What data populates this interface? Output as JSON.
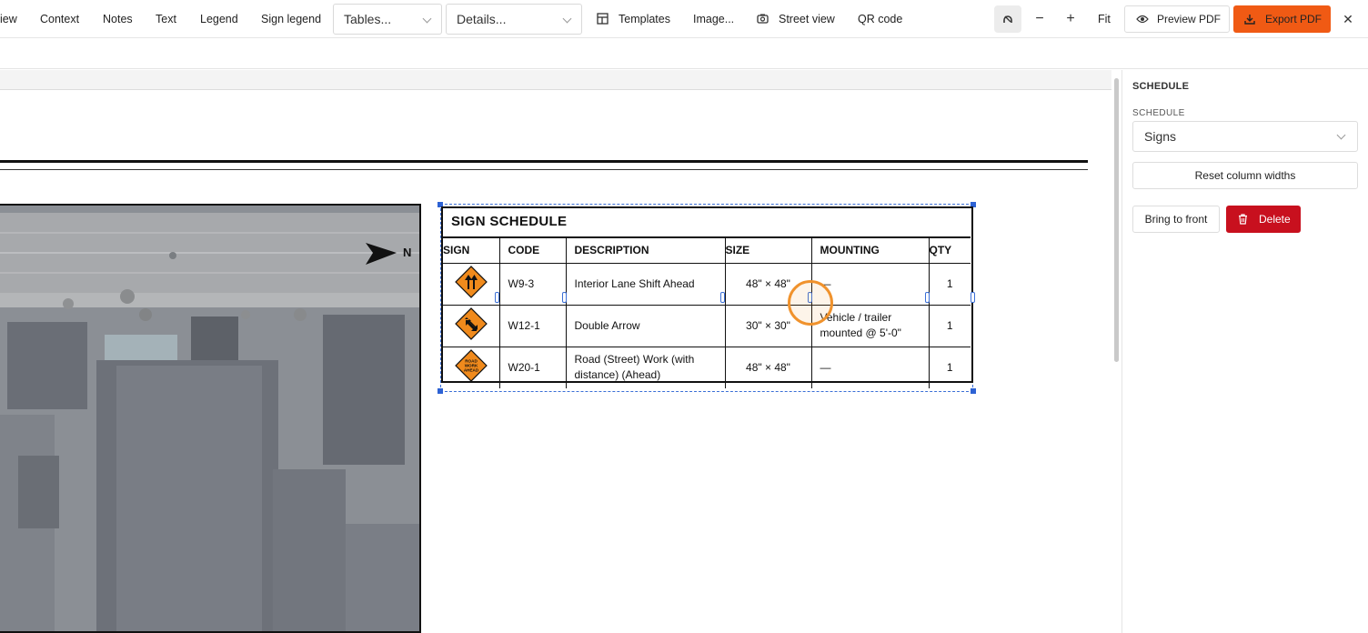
{
  "toolbar": {
    "items": {
      "view": "iew",
      "context": "Context",
      "notes": "Notes",
      "text": "Text",
      "legend": "Legend",
      "sign_legend": "Sign legend",
      "templates": "Templates",
      "image": "Image...",
      "street_view": "Street view",
      "qr_code": "QR code",
      "fit": "Fit"
    },
    "tables_select": "Tables...",
    "details_select": "Details...",
    "zoom_out": "−",
    "zoom_in": "+",
    "preview_pdf": "Preview PDF",
    "export_pdf": "Export PDF",
    "close": "✕"
  },
  "map": {
    "north_label": "N"
  },
  "schedule_table": {
    "title": "SIGN SCHEDULE",
    "columns": [
      "SIGN",
      "CODE",
      "DESCRIPTION",
      "SIZE",
      "MOUNTING",
      "QTY"
    ],
    "rows": [
      {
        "sign_icon": "interior-lane-shift-sign-icon",
        "code": "W9-3",
        "description": "Interior Lane Shift Ahead",
        "size": "48\" × 48\"",
        "mounting": "—",
        "qty": "1"
      },
      {
        "sign_icon": "double-arrow-sign-icon",
        "code": "W12-1",
        "description": "Double Arrow",
        "size": "30\" × 30\"",
        "mounting": "Vehicle / trailer mounted @ 5'-0\"",
        "qty": "1"
      },
      {
        "sign_icon": "road-work-ahead-sign-icon",
        "sign_text": [
          "ROAD",
          "WORK",
          "AHEAD"
        ],
        "code": "W20-1",
        "description": "Road (Street) Work (with distance) (Ahead)",
        "size": "48\" × 48\"",
        "mounting": "—",
        "qty": "1"
      }
    ]
  },
  "panel": {
    "heading": "SCHEDULE",
    "schedule_label": "SCHEDULE",
    "schedule_value": "Signs",
    "reset_button": "Reset column widths",
    "bring_front_button": "Bring to front",
    "delete_button": "Delete"
  },
  "colors": {
    "accent_orange": "#f05a14",
    "danger_red": "#c8101e",
    "selection_blue": "#2d62d4",
    "sign_orange": "#f08a1c"
  }
}
